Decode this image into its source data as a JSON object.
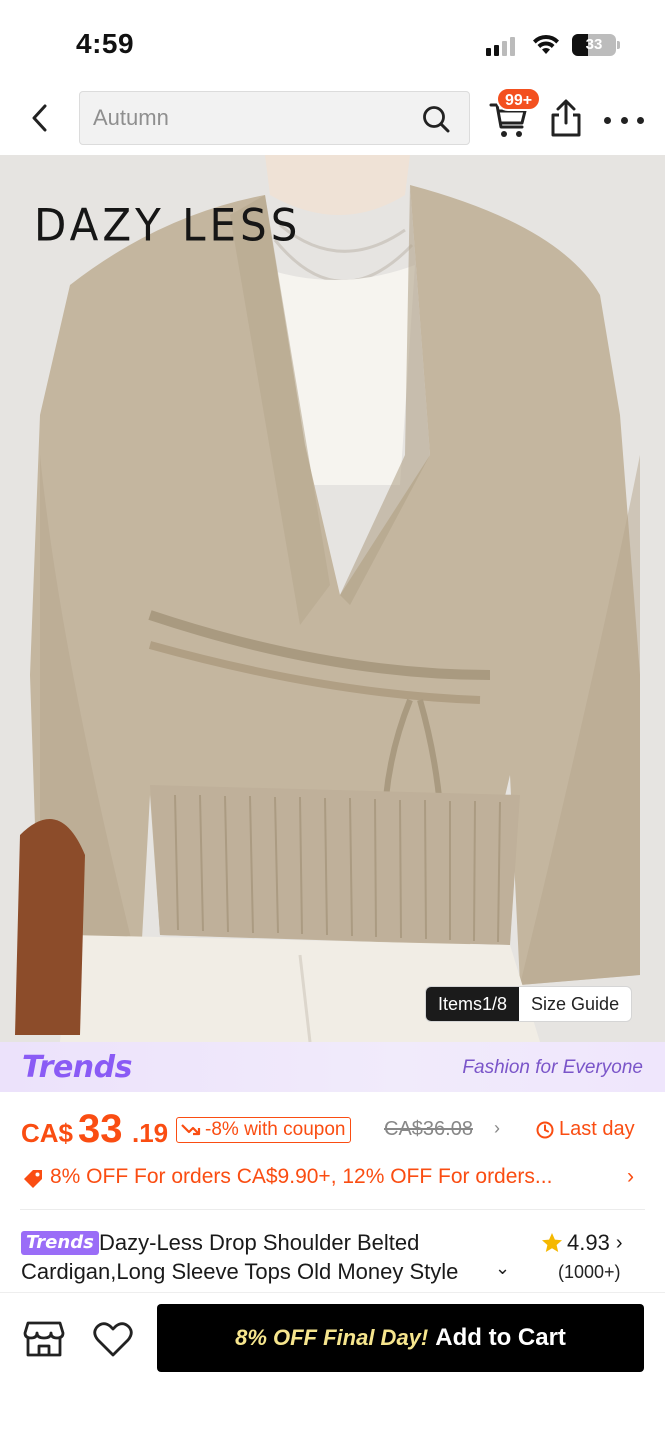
{
  "status_bar": {
    "time": "4:59",
    "battery": "33"
  },
  "header": {
    "search": {
      "placeholder": "Autumn"
    },
    "cart_badge": "99+"
  },
  "gallery": {
    "brand_logo": "DAZY LESS",
    "items_counter": "Items1/8",
    "size_guide": "Size Guide"
  },
  "trends_banner": {
    "logo": "Trends",
    "tagline": "Fashion for Everyone"
  },
  "price": {
    "currency": "CA$",
    "whole": "33",
    "cents": ".19",
    "coupon": "-8% with coupon",
    "original": "CA$36.08",
    "deadline": "Last day"
  },
  "promo": {
    "text": "8% OFF For orders CA$9.90+,  12% OFF For orders..."
  },
  "product": {
    "badge": "Trends",
    "title": "Dazy-Less Drop Shoulder Belted Cardigan,Long Sleeve Tops Old Money Style",
    "rating": "4.93",
    "reviews": "(1000+)"
  },
  "bottom_bar": {
    "cart_promo": "8% OFF Final Day!",
    "add_to_cart": "Add to Cart"
  },
  "colors": {
    "accent": "#fa4d12",
    "trends": "#8a5bf5",
    "cart_button": "#000000"
  },
  "icons": [
    "back-icon",
    "search-icon",
    "cart-icon",
    "share-icon",
    "more-icon",
    "store-icon",
    "heart-icon",
    "star-icon",
    "clock-icon",
    "tag-icon",
    "price-down-icon"
  ]
}
